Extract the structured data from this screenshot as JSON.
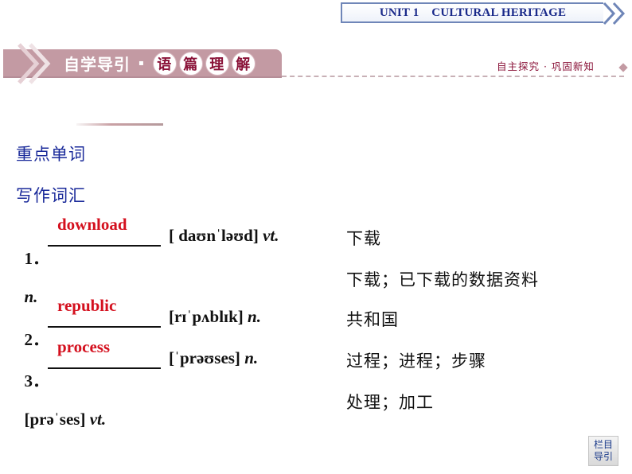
{
  "header": {
    "unit_title": "UNIT 1    CULTURAL HERITAGE"
  },
  "banner": {
    "section_label": "自学导引",
    "separator": "▪",
    "circled_chars": [
      "语",
      "篇",
      "理",
      "解"
    ],
    "right_subtitle": "自主探究 · 巩固新知",
    "colors": {
      "banner": "#c39aa3",
      "accent": "#8a1238",
      "heading_blue": "#1a2a9a",
      "answer_red": "#d4101e"
    }
  },
  "headings": {
    "main": "重点单词",
    "sub": "写作词汇"
  },
  "vocab": [
    {
      "number": "1．",
      "answer": "download",
      "phonetic": "[ daʊnˈləʊd]",
      "pos": "vt.",
      "meaning": "下载"
    },
    {
      "number": "",
      "answer": "",
      "phonetic": "",
      "pos": "n.",
      "meaning": "下载；已下载的数据资料"
    },
    {
      "number": "2．",
      "answer": "republic",
      "phonetic": "[rɪˈpʌblɪk]",
      "pos": "n.",
      "meaning": "共和国"
    },
    {
      "number": "3．",
      "answer": "process",
      "phonetic": "[ˈprəʊses]",
      "pos": "n.",
      "meaning": "过程；进程；步骤"
    },
    {
      "number": "",
      "answer": "",
      "phonetic": "[prəˈses]",
      "pos": "vt.",
      "meaning": "处理；加工"
    }
  ],
  "nav_button": {
    "line1": "栏目",
    "line2": "导引"
  }
}
